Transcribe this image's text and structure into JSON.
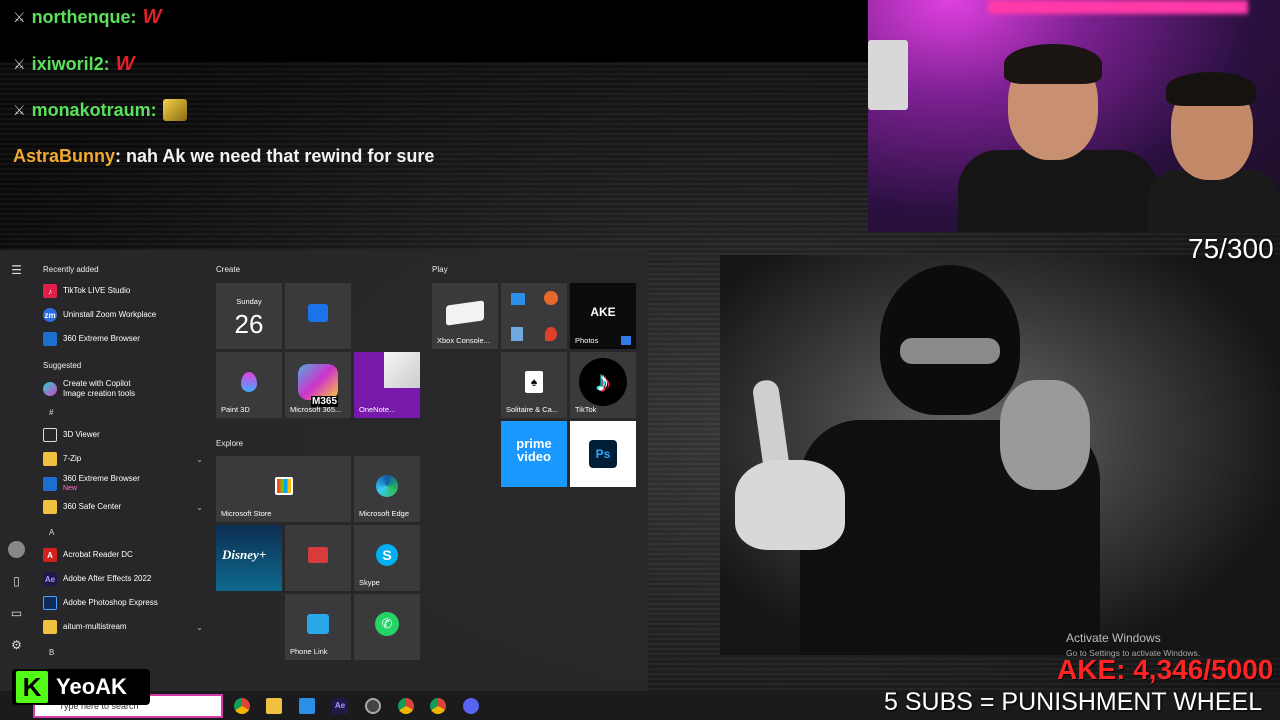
{
  "chat": [
    {
      "user": "northenque:",
      "user_color": "#5be05b",
      "emote": "W",
      "message": ""
    },
    {
      "user": "ixiworil2:",
      "user_color": "#5be05b",
      "emote": "W",
      "message": ""
    },
    {
      "user": "monakotraum:",
      "user_color": "#5be05b",
      "emote": "emote",
      "message": ""
    },
    {
      "user": "AstraBunny",
      "user_color": "#f0a830",
      "emote": "",
      "message": ": nah Ak we need that rewind for sure"
    }
  ],
  "webcam_counter": "75/300",
  "start_menu": {
    "recently_added_label": "Recently added",
    "recently_added": [
      {
        "label": "TikTok LIVE Studio",
        "icon": "tiktok-icon"
      },
      {
        "label": "Uninstall Zoom Workplace",
        "icon": "zoom-icon"
      },
      {
        "label": "360 Extreme Browser",
        "icon": "browser-icon"
      }
    ],
    "suggested_label": "Suggested",
    "suggested": [
      {
        "label": "Create with Copilot",
        "sub": "Image creation tools",
        "icon": "copilot-icon"
      }
    ],
    "hash_letter": "#",
    "hash_items": [
      {
        "label": "3D Viewer",
        "icon": "cube-icon"
      },
      {
        "label": "7-Zip",
        "icon": "folder-icon"
      },
      {
        "label": "360 Extreme Browser",
        "sub": "New",
        "icon": "browser-icon"
      },
      {
        "label": "360 Safe Center",
        "icon": "folder-icon"
      }
    ],
    "a_letter": "A",
    "a_items": [
      {
        "label": "Acrobat Reader DC",
        "icon": "acrobat-icon"
      },
      {
        "label": "Adobe After Effects 2022",
        "icon": "after-effects-icon"
      },
      {
        "label": "Adobe Photoshop Express",
        "icon": "photoshop-express-icon"
      },
      {
        "label": "aitum-multistream",
        "icon": "folder-icon"
      }
    ],
    "b_letter": "B",
    "groups": {
      "create": "Create",
      "explore": "Explore",
      "play": "Play"
    },
    "calendar": {
      "day": "Sunday",
      "date": "26"
    },
    "tiles": {
      "paint3d": "Paint 3D",
      "m365": "Microsoft 365...",
      "m365_badge": "M365",
      "onenote": "OneNote...",
      "store": "Microsoft Store",
      "edge": "Microsoft Edge",
      "disney": "Disney+",
      "skype": "Skype",
      "phone_link": "Phone Link",
      "xbox": "Xbox Console...",
      "photos": "Photos",
      "photos_text": "AKE",
      "solitaire": "Solitaire & Ca...",
      "tiktok": "TikTok",
      "prime": "prime video",
      "ps": "Ps"
    }
  },
  "taskbar": {
    "search_placeholder": "Type here to search"
  },
  "activate": {
    "title": "Activate Windows",
    "subtitle": "Go to Settings to activate Windows."
  },
  "ake_counter": "AKE: 4,346/5000",
  "subs_banner": "5 SUBS = PUNISHMENT WHEEL",
  "kick": {
    "logo_letter": "K",
    "name": "YeoAK"
  },
  "colors": {
    "kick_green": "#53fc18",
    "counter_red": "#ff2424",
    "search_border": "#d23aa8"
  }
}
